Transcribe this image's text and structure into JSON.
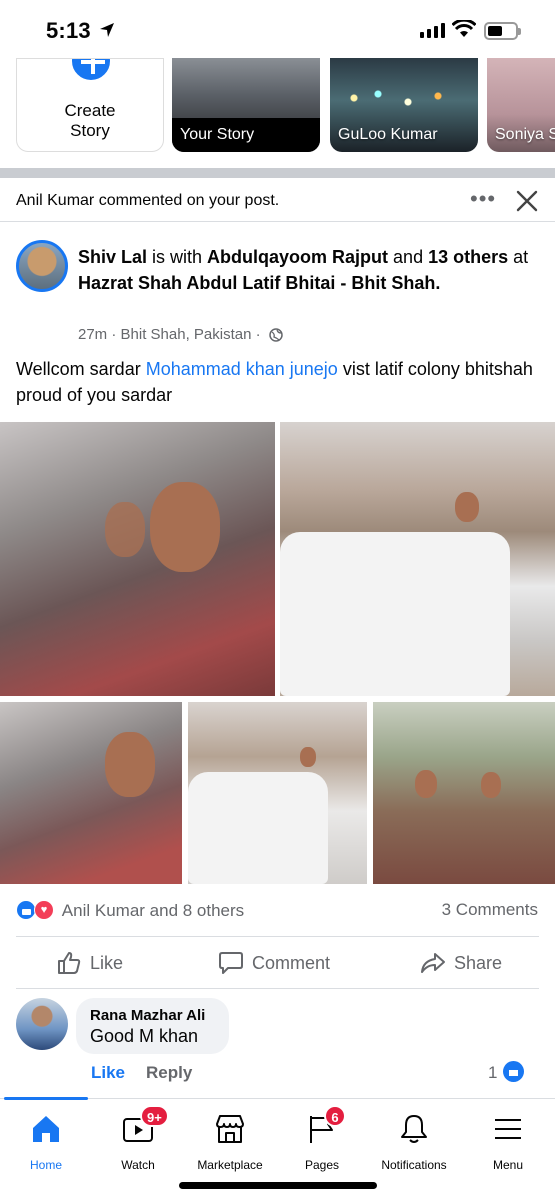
{
  "status_bar": {
    "time": "5:13"
  },
  "stories": {
    "create_label": "Create Story",
    "items": [
      {
        "name": "Your Story"
      },
      {
        "name": "GuLoo Kumar"
      },
      {
        "name": "Soniya S"
      }
    ]
  },
  "notification": {
    "text": "Anil Kumar commented on your post."
  },
  "post": {
    "author": "Shiv Lal",
    "is_with": " is with ",
    "tagged": "Abdulqayoom Rajput",
    "and": " and ",
    "others": "13 others",
    "at": " at ",
    "place": "Hazrat Shah Abdul Latif Bhitai - Bhit Shah.",
    "time": "27m",
    "location": "Bhit Shah, Pakistan",
    "text_before": "Wellcom  sardar ",
    "mention": "Mohammad khan junejo",
    "text_after": "  vist  latif colony bhitshah  proud  of you  sardar"
  },
  "reactions": {
    "summary": "Anil Kumar and 8 others",
    "comments": "3 Comments"
  },
  "actions": {
    "like": "Like",
    "comment": "Comment",
    "share": "Share"
  },
  "comment": {
    "author": "Rana Mazhar Ali",
    "text": "Good M khan",
    "like": "Like",
    "reply": "Reply",
    "like_count": "1"
  },
  "nav": {
    "home": "Home",
    "watch": "Watch",
    "watch_badge": "9+",
    "marketplace": "Marketplace",
    "pages": "Pages",
    "pages_badge": "6",
    "notifications": "Notifications",
    "menu": "Menu"
  },
  "colors": {
    "accent": "#1877f2",
    "badge": "#e41e3f",
    "secondary_text": "#65676b"
  }
}
